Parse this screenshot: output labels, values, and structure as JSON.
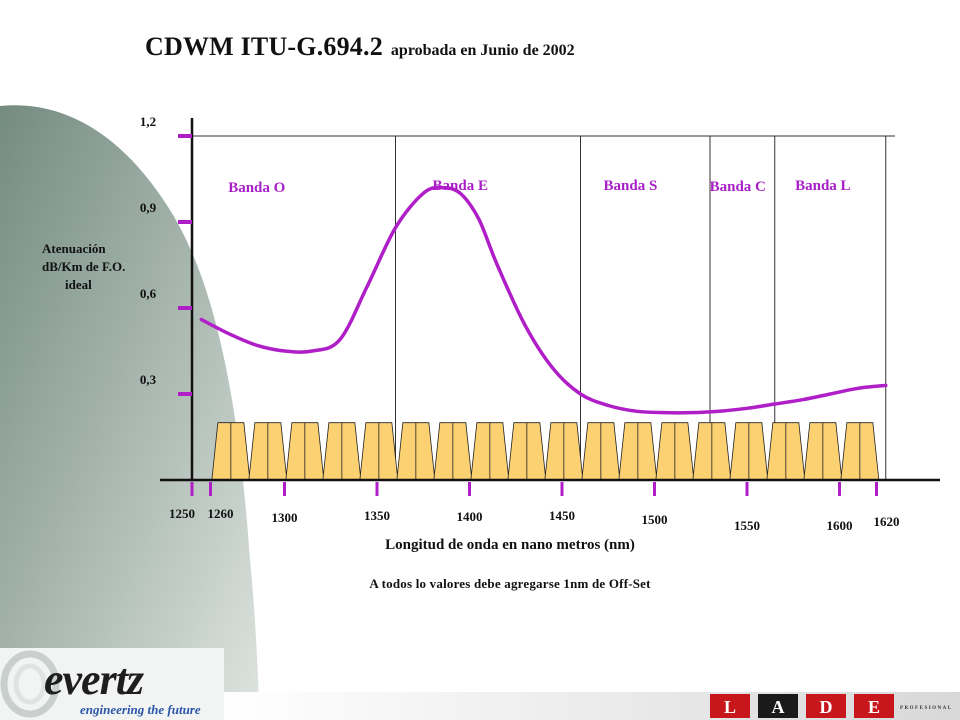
{
  "title": {
    "main": "CDWM ITU-G.694.2",
    "sub": "aprobada en  Junio de 2002"
  },
  "chart_data": {
    "type": "line",
    "title": "CDWM ITU-G.694.2 aprobada en  Junio de 2002",
    "ylabel_lines": [
      "Atenuación",
      "dB/Km de F.O.",
      "ideal"
    ],
    "xlabel": "Longitud de onda en nano metros (nm)",
    "note": "A todos lo valores debe agregarse 1nm de Off-Set",
    "xlim": [
      1250,
      1630
    ],
    "ylim": [
      0.0,
      1.2
    ],
    "y_ticks": [
      {
        "value": 1.2,
        "label": "1,2"
      },
      {
        "value": 0.9,
        "label": "0,9"
      },
      {
        "value": 0.6,
        "label": "0,6"
      },
      {
        "value": 0.3,
        "label": "0,3"
      }
    ],
    "x_ticks": [
      {
        "value": 1250,
        "label": "1250"
      },
      {
        "value": 1260,
        "label": "1260"
      },
      {
        "value": 1300,
        "label": "1300"
      },
      {
        "value": 1350,
        "label": "1350"
      },
      {
        "value": 1400,
        "label": "1400"
      },
      {
        "value": 1450,
        "label": "1450"
      },
      {
        "value": 1500,
        "label": "1500"
      },
      {
        "value": 1550,
        "label": "1550"
      },
      {
        "value": 1600,
        "label": "1600"
      },
      {
        "value": 1620,
        "label": "1620"
      }
    ],
    "bands": [
      {
        "name": "Banda O",
        "start": 1260,
        "end": 1360
      },
      {
        "name": "Banda E",
        "start": 1360,
        "end": 1460
      },
      {
        "name": "Banda S",
        "start": 1460,
        "end": 1530
      },
      {
        "name": "Banda C",
        "start": 1530,
        "end": 1565
      },
      {
        "name": "Banda L",
        "start": 1565,
        "end": 1625
      }
    ],
    "channels_nm": [
      1271,
      1291,
      1311,
      1331,
      1351,
      1371,
      1391,
      1411,
      1431,
      1451,
      1471,
      1491,
      1511,
      1531,
      1551,
      1571,
      1591,
      1611
    ],
    "channel_height": 0.2,
    "attenuation_curve": {
      "x": [
        1255,
        1270,
        1285,
        1300,
        1315,
        1330,
        1345,
        1360,
        1375,
        1385,
        1395,
        1405,
        1415,
        1430,
        1445,
        1460,
        1475,
        1490,
        1505,
        1520,
        1535,
        1550,
        1565,
        1580,
        1595,
        1610,
        1625
      ],
      "y": [
        0.56,
        0.51,
        0.47,
        0.45,
        0.45,
        0.49,
        0.68,
        0.88,
        1.0,
        1.02,
        1.0,
        0.91,
        0.75,
        0.54,
        0.39,
        0.3,
        0.26,
        0.24,
        0.235,
        0.235,
        0.24,
        0.25,
        0.265,
        0.28,
        0.3,
        0.32,
        0.33
      ]
    },
    "colors": {
      "curve": "#b01ec8",
      "ticks": "#b01ec8",
      "channel_fill": "#fcd172",
      "axis": "#111111",
      "band_divider": "#333333",
      "band_label": "#a81ec8"
    }
  },
  "logos": {
    "evertz_wordmark": "evertz",
    "evertz_tagline": "engineering the future",
    "lade_letters": [
      "L",
      "A",
      "D",
      "E"
    ],
    "lade_tag": "PROFESIONAL"
  }
}
